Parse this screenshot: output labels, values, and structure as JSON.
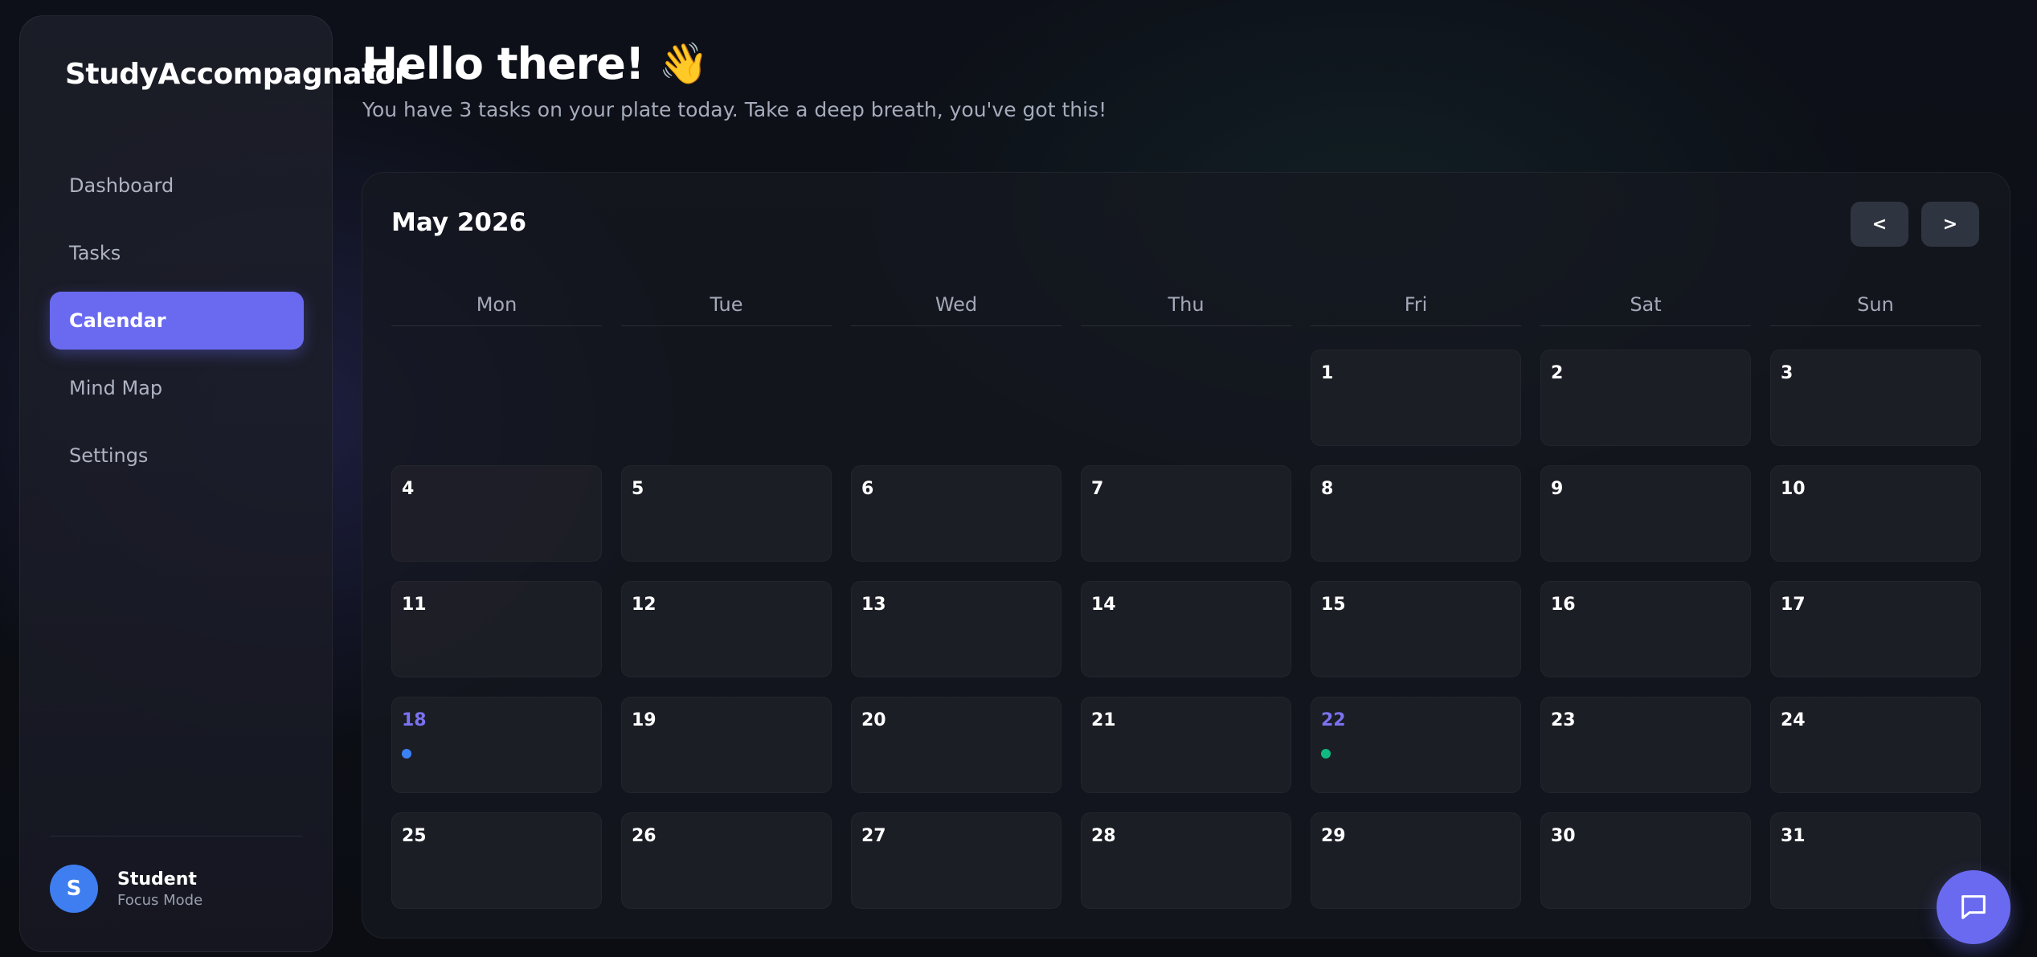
{
  "sidebar": {
    "brand": "StudyAccompagnator",
    "nav": [
      {
        "label": "Dashboard",
        "active": false
      },
      {
        "label": "Tasks",
        "active": false
      },
      {
        "label": "Calendar",
        "active": true
      },
      {
        "label": "Mind Map",
        "active": false
      },
      {
        "label": "Settings",
        "active": false
      }
    ],
    "user": {
      "initial": "S",
      "name": "Student",
      "status": "Focus Mode"
    }
  },
  "header": {
    "greeting": "Hello there!",
    "wave_emoji": "👋",
    "subtitle": "You have 3 tasks on your plate today. Take a deep breath, you've got this!"
  },
  "calendar": {
    "month_label": "May 2026",
    "prev_label": "<",
    "next_label": ">",
    "weekdays": [
      "Mon",
      "Tue",
      "Wed",
      "Thu",
      "Fri",
      "Sat",
      "Sun"
    ],
    "leading_blanks": 4,
    "days": [
      {
        "n": "1"
      },
      {
        "n": "2"
      },
      {
        "n": "3"
      },
      {
        "n": "4"
      },
      {
        "n": "5"
      },
      {
        "n": "6"
      },
      {
        "n": "7"
      },
      {
        "n": "8"
      },
      {
        "n": "9"
      },
      {
        "n": "10"
      },
      {
        "n": "11"
      },
      {
        "n": "12"
      },
      {
        "n": "13"
      },
      {
        "n": "14"
      },
      {
        "n": "15"
      },
      {
        "n": "16"
      },
      {
        "n": "17"
      },
      {
        "n": "18",
        "highlight": true,
        "dot": "#3b82f6"
      },
      {
        "n": "19"
      },
      {
        "n": "20"
      },
      {
        "n": "21"
      },
      {
        "n": "22",
        "highlight": true,
        "dot": "#10b981"
      },
      {
        "n": "23"
      },
      {
        "n": "24"
      },
      {
        "n": "25"
      },
      {
        "n": "26"
      },
      {
        "n": "27"
      },
      {
        "n": "28"
      },
      {
        "n": "29"
      },
      {
        "n": "30"
      },
      {
        "n": "31"
      }
    ]
  },
  "colors": {
    "accent": "#6a6af0",
    "highlight_text": "#7b72f0",
    "avatar": "#3f7ef0"
  },
  "chat_button": {
    "icon": "chat-bubble-icon"
  }
}
